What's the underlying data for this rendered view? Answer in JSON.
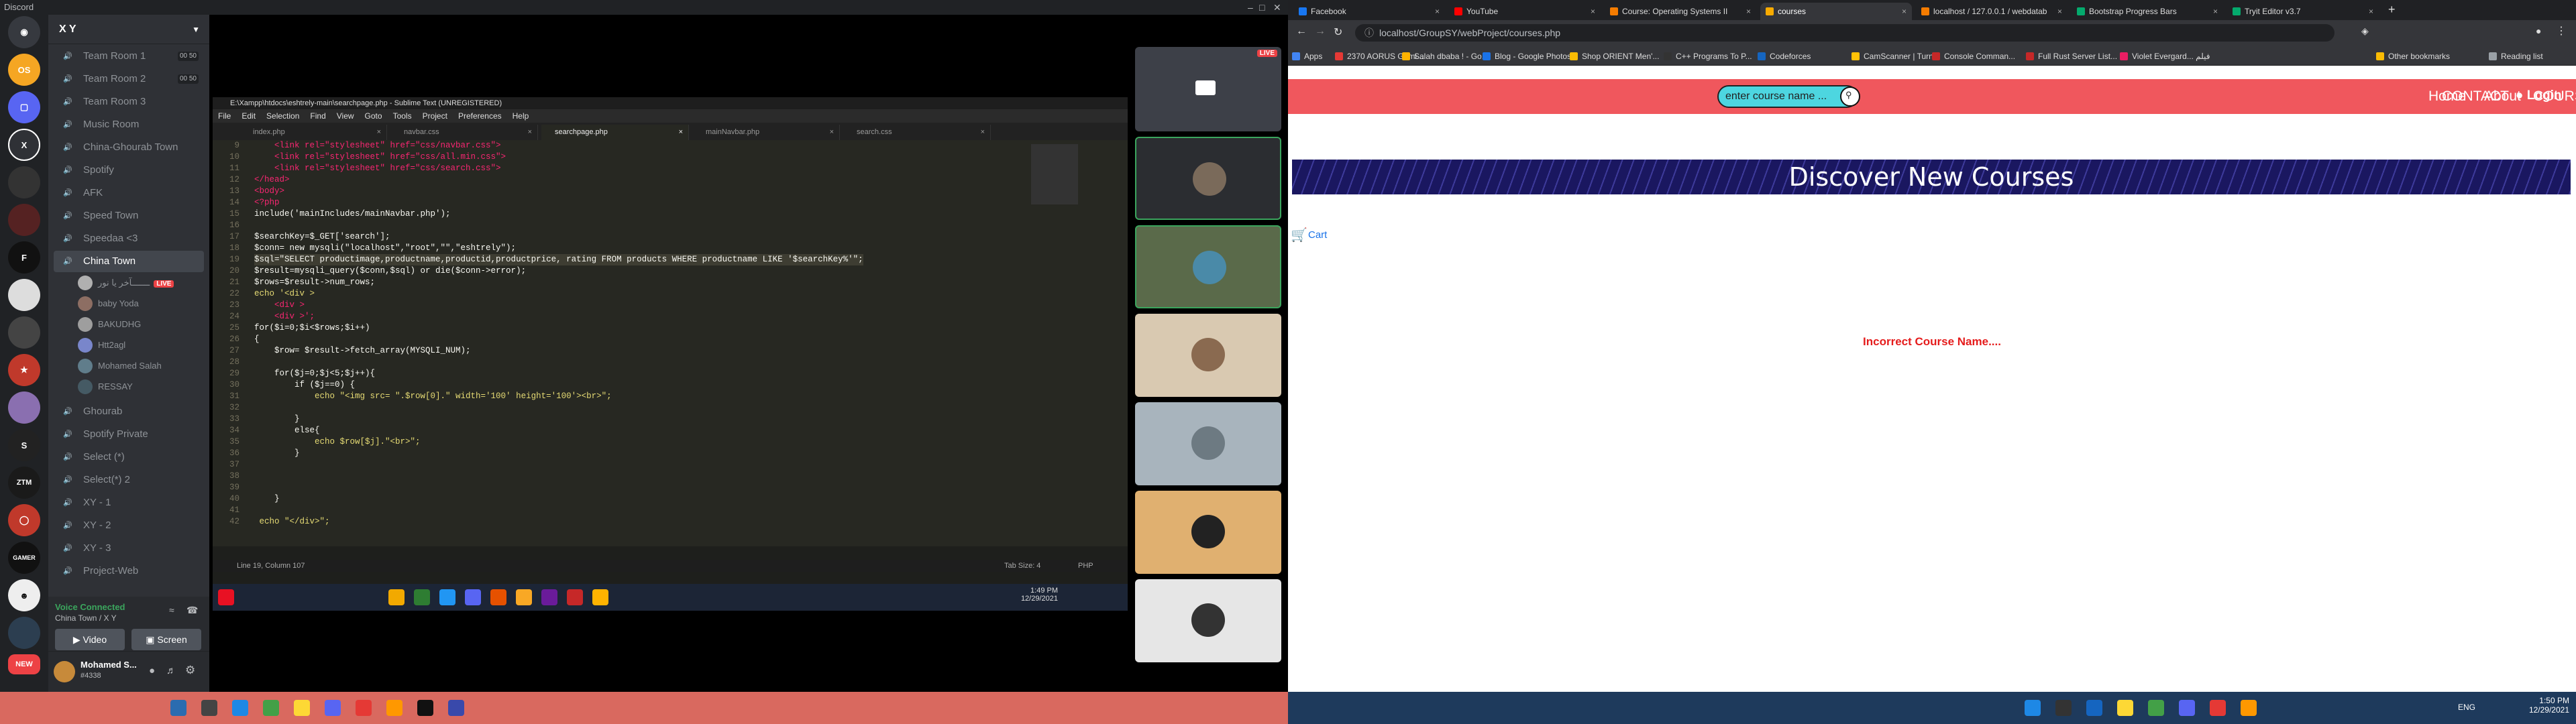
{
  "discord": {
    "app_title": "Discord",
    "server_name": "X Y",
    "channels": [
      {
        "label": "Team Room 1",
        "limit": "00 50"
      },
      {
        "label": "Team Room 2",
        "limit": "00 50"
      },
      {
        "label": "Team Room 3",
        "limit": ""
      },
      {
        "label": "Music Room",
        "limit": ""
      },
      {
        "label": "China-Ghourab Town",
        "limit": ""
      },
      {
        "label": "Spotify",
        "limit": ""
      },
      {
        "label": "AFK",
        "limit": ""
      },
      {
        "label": "Speed Town",
        "limit": ""
      },
      {
        "label": "Speedaa <3",
        "limit": ""
      },
      {
        "label": "China Town",
        "limit": ""
      }
    ],
    "voice_users": [
      {
        "name": "ـــــــآخر يا نور",
        "badge": "LIVE"
      },
      {
        "name": "baby Yoda",
        "badge": ""
      },
      {
        "name": "BAKUDHG",
        "badge": ""
      },
      {
        "name": "Htt2agl",
        "badge": ""
      },
      {
        "name": "Mohamed Salah",
        "badge": ""
      },
      {
        "name": "RESSAY",
        "badge": ""
      }
    ],
    "more_channels": [
      {
        "label": "Ghourab"
      },
      {
        "label": "Spotify Private"
      },
      {
        "label": "Select (*)"
      },
      {
        "label": "Select(*) 2"
      },
      {
        "label": "XY - 1"
      },
      {
        "label": "XY - 2"
      },
      {
        "label": "XY - 3"
      },
      {
        "label": "Project-Web"
      }
    ],
    "voice_connected": "Voice Connected",
    "voice_location": "China Town / X Y",
    "video_label": "Video",
    "screen_label": "Screen",
    "user_name": "Mohamed S...",
    "user_tag": "#4338",
    "stream_live": "LIVE"
  },
  "sublime": {
    "title": "E:\\Xampp\\htdocs\\eshtrely-main\\searchpage.php - Sublime Text (UNREGISTERED)",
    "menu": [
      "File",
      "Edit",
      "Selection",
      "Find",
      "View",
      "Goto",
      "Tools",
      "Project",
      "Preferences",
      "Help"
    ],
    "tabs": [
      "index.php",
      "navbar.css",
      "searchpage.php",
      "mainNavbar.php",
      "search.css"
    ],
    "code": [
      {
        "n": "9",
        "t": "    <link rel=\"stylesheet\" href=\"css/navbar.css\">"
      },
      {
        "n": "10",
        "t": "    <link rel=\"stylesheet\" href=\"css/all.min.css\">"
      },
      {
        "n": "11",
        "t": "    <link rel=\"stylesheet\" href=\"css/search.css\">"
      },
      {
        "n": "12",
        "t": "</head>"
      },
      {
        "n": "13",
        "t": "<body>"
      },
      {
        "n": "14",
        "t": "<?php"
      },
      {
        "n": "15",
        "t": "include('mainIncludes/mainNavbar.php');"
      },
      {
        "n": "16",
        "t": ""
      },
      {
        "n": "17",
        "t": "$searchKey=$_GET['search'];"
      },
      {
        "n": "18",
        "t": "$conn= new mysqli(\"localhost\",\"root\",\"\",\"eshtrely\");"
      },
      {
        "n": "19",
        "t": "$sql=\"SELECT productimage,productname,productid,productprice, rating FROM products WHERE productname LIKE '$searchKey%'\";"
      },
      {
        "n": "20",
        "t": "$result=mysqli_query($conn,$sql) or die($conn->error);"
      },
      {
        "n": "21",
        "t": "$rows=$result->num_rows;"
      },
      {
        "n": "22",
        "t": "echo '<div >"
      },
      {
        "n": "23",
        "t": "    <div >"
      },
      {
        "n": "24",
        "t": "    <div >';"
      },
      {
        "n": "25",
        "t": "for($i=0;$i<$rows;$i++)"
      },
      {
        "n": "26",
        "t": "{"
      },
      {
        "n": "27",
        "t": "    $row= $result->fetch_array(MYSQLI_NUM);"
      },
      {
        "n": "28",
        "t": ""
      },
      {
        "n": "29",
        "t": "    for($j=0;$j<5;$j++){"
      },
      {
        "n": "30",
        "t": "        if ($j==0) {"
      },
      {
        "n": "31",
        "t": "            echo \"<img src= \".$row[0].\" width='100' height='100'><br>\";"
      },
      {
        "n": "32",
        "t": ""
      },
      {
        "n": "33",
        "t": "        }"
      },
      {
        "n": "34",
        "t": "        else{"
      },
      {
        "n": "35",
        "t": "            echo $row[$j].\"<br>\";"
      },
      {
        "n": "36",
        "t": "        }"
      },
      {
        "n": "37",
        "t": ""
      },
      {
        "n": "38",
        "t": ""
      },
      {
        "n": "39",
        "t": ""
      },
      {
        "n": "40",
        "t": "    }"
      },
      {
        "n": "41",
        "t": ""
      },
      {
        "n": "42",
        "t": " echo \"</div>\";"
      }
    ],
    "status_left": "Line 19, Column 107",
    "status_tab": "Tab Size: 4",
    "status_lang": "PHP",
    "stream_time": "1:49 PM",
    "stream_date": "12/29/2021"
  },
  "chrome": {
    "tabs": [
      {
        "label": "Facebook",
        "color": "#1877f2"
      },
      {
        "label": "YouTube",
        "color": "#ff0000"
      },
      {
        "label": "Course: Operating Systems II",
        "color": "#f57c00"
      },
      {
        "label": "courses",
        "color": "#f9ab00"
      },
      {
        "label": "localhost / 127.0.0.1 / webdatab",
        "color": "#f57c00"
      },
      {
        "label": "Bootstrap Progress Bars",
        "color": "#04aa6d"
      },
      {
        "label": "Tryit Editor v3.7",
        "color": "#04aa6d"
      }
    ],
    "url": "localhost/GroupSY/webProject/courses.php",
    "bookmarks": [
      "Apps",
      "2370 AORUS Gami...",
      "Salah dbaba ! - Go...",
      "Blog - Google Photos",
      "Shop ORIENT Men'...",
      "C++ Programs To P...",
      "Codeforces",
      "CamScanner | Turn...",
      "Console Comman...",
      "Full Rust Server List...",
      "Violet Evergard... فيلم"
    ],
    "other_bookmarks": "Other bookmarks",
    "reading_list": "Reading list"
  },
  "page": {
    "search_placeholder": "enter course name ...",
    "nav": [
      "Home",
      "About",
      "COURSES",
      "CONTACT",
      "Login"
    ],
    "banner_title": "Discover New Courses",
    "cart_label": "Cart",
    "error_message": "Incorrect Course Name...."
  },
  "taskbar": {
    "lang": "ENG",
    "time": "1:50 PM",
    "date": "12/29/2021"
  }
}
